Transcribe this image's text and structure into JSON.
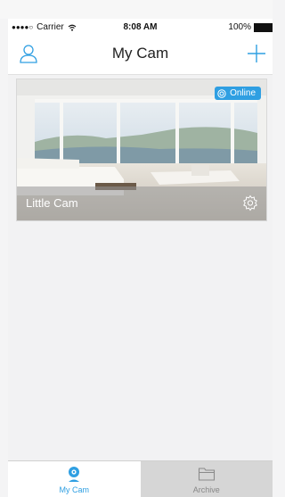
{
  "status_bar": {
    "carrier": "Carrier",
    "time": "8:08 AM",
    "battery": "100%"
  },
  "nav": {
    "title": "My Cam",
    "left_icon": "profile-icon",
    "right_icon": "plus-icon"
  },
  "cameras": [
    {
      "name": "Little Cam",
      "status": "Online",
      "thumbnail": "living-room-scene"
    }
  ],
  "tabs": [
    {
      "label": "My Cam",
      "icon": "camera-icon",
      "active": true
    },
    {
      "label": "Archive",
      "icon": "folder-icon",
      "active": false
    }
  ],
  "colors": {
    "accent": "#2f9fe2",
    "background": "#f2f2f3",
    "inactive_tab": "#d6d6d6"
  }
}
